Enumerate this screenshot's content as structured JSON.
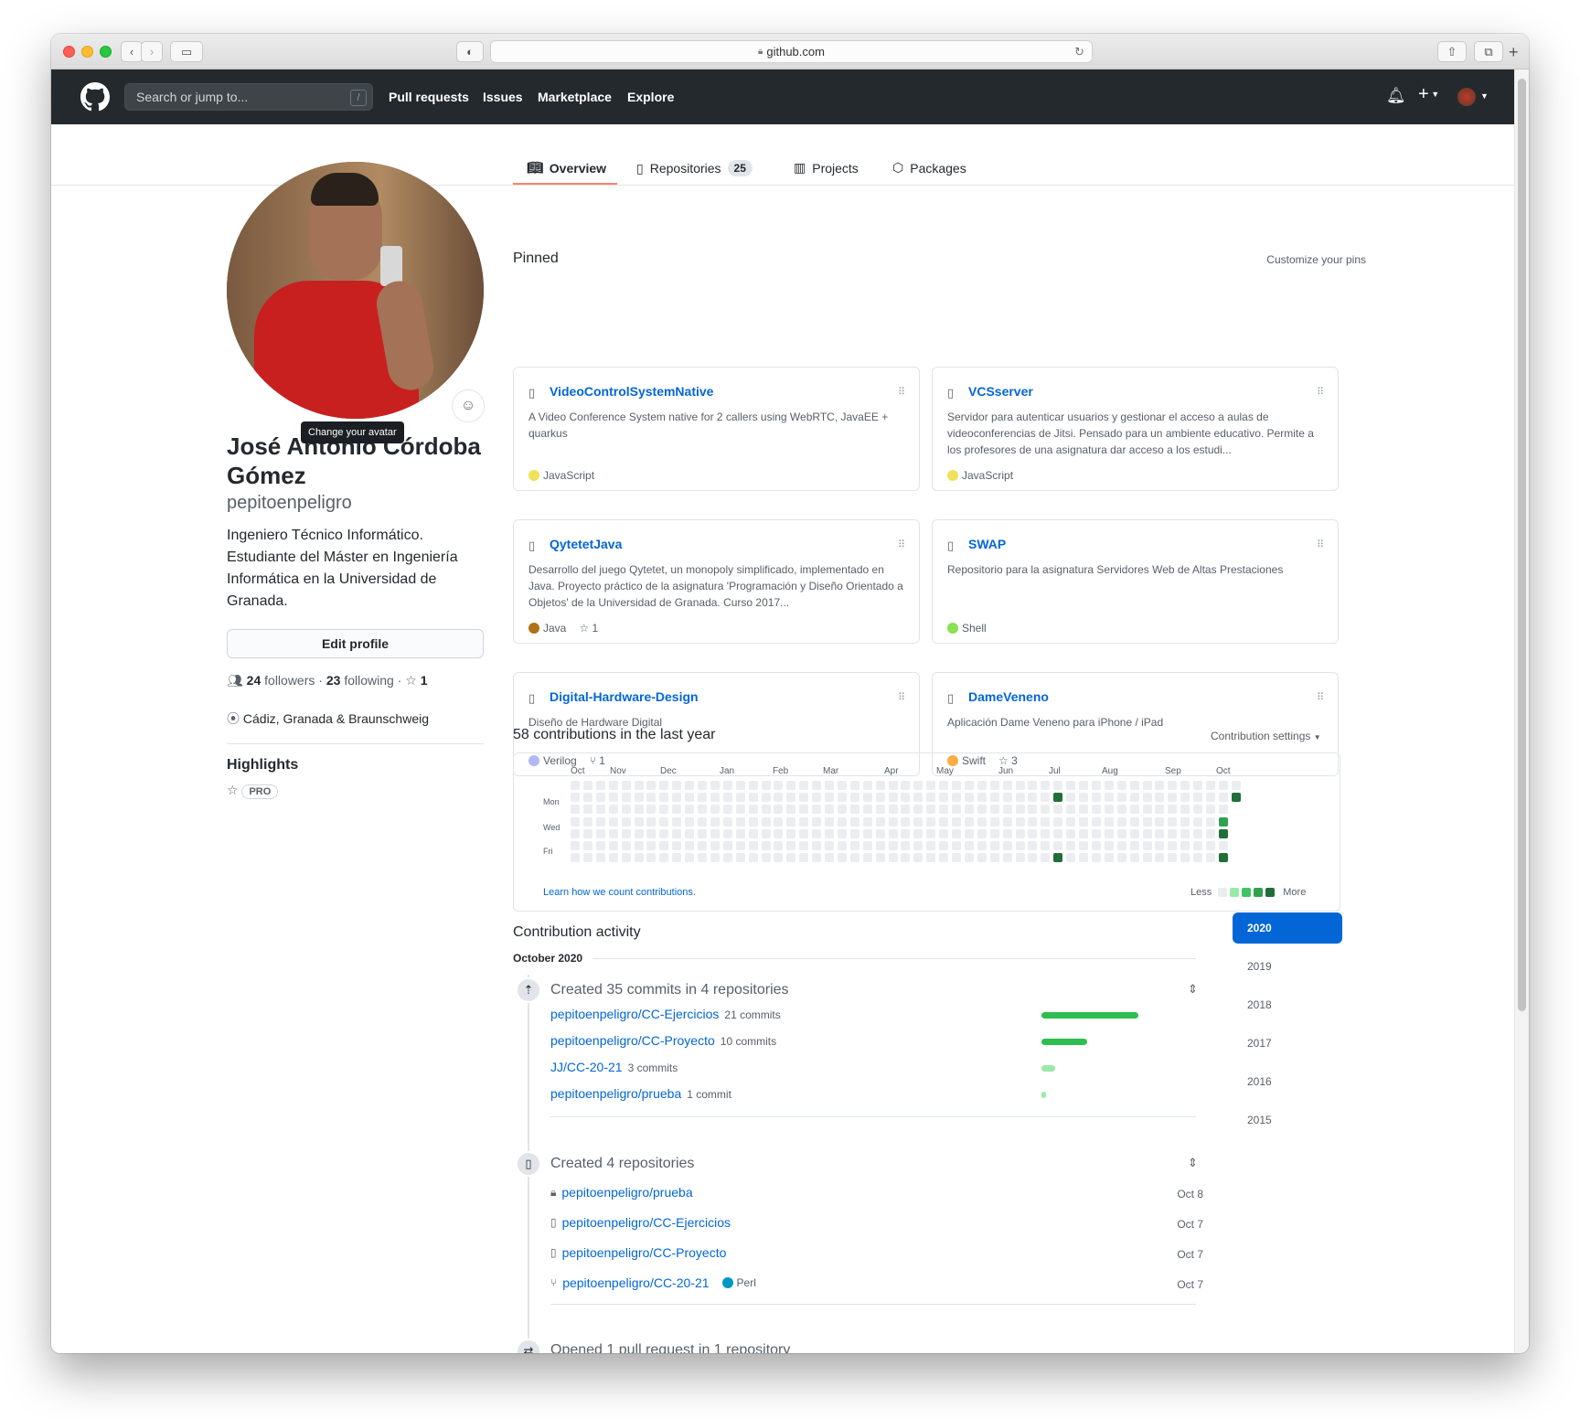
{
  "browser": {
    "url": "github.com"
  },
  "header": {
    "search_placeholder": "Search or jump to...",
    "search_key": "/",
    "nav": [
      "Pull requests",
      "Issues",
      "Marketplace",
      "Explore"
    ]
  },
  "tabs": {
    "overview": "Overview",
    "repositories": "Repositories",
    "repositories_count": "25",
    "projects": "Projects",
    "packages": "Packages"
  },
  "profile": {
    "tooltip": "Change your avatar",
    "name": "José Antonio Córdoba Gómez",
    "username": "pepitoenpeligro",
    "bio": "Ingeniero Técnico Informático. Estudiante del Máster en Ingeniería Informática en la Universidad de Granada.",
    "edit": "Edit profile",
    "followers": "24",
    "followers_label": "followers",
    "following": "23",
    "following_label": "following",
    "stars": "1",
    "location": "Cádiz, Granada & Braunschweig",
    "highlights": "Highlights",
    "pro": "PRO"
  },
  "pinned": {
    "title": "Pinned",
    "customize": "Customize your pins",
    "cards": [
      {
        "name": "VideoControlSystemNative",
        "desc": "A Video Conference System native for 2 callers using WebRTC, JavaEE + quarkus",
        "lang": "JavaScript",
        "color": "#f1e05a",
        "stars": "",
        "forks": ""
      },
      {
        "name": "VCSserver",
        "desc": "Servidor para autenticar usuarios y gestionar el acceso a aulas de videoconferencias de Jitsi. Pensado para un ambiente educativo. Permite a los profesores de una asignatura dar acceso a los estudi...",
        "lang": "JavaScript",
        "color": "#f1e05a",
        "stars": "",
        "forks": ""
      },
      {
        "name": "QytetetJava",
        "desc": "Desarrollo del juego Qytetet, un monopoly simplificado, implementado en Java. Proyecto práctico de la asignatura 'Programación y Diseño Orientado a Objetos' de la Universidad de Granada. Curso 2017...",
        "lang": "Java",
        "color": "#b07219",
        "stars": "1",
        "forks": ""
      },
      {
        "name": "SWAP",
        "desc": "Repositorio para la asignatura Servidores Web de Altas Prestaciones",
        "lang": "Shell",
        "color": "#89e051",
        "stars": "",
        "forks": ""
      },
      {
        "name": "Digital-Hardware-Design",
        "desc": "Diseño de Hardware Digital",
        "lang": "Verilog",
        "color": "#b2b7f8",
        "stars": "",
        "forks": "1"
      },
      {
        "name": "DameVeneno",
        "desc": "Aplicación Dame Veneno para iPhone / iPad",
        "lang": "Swift",
        "color": "#ffac45",
        "stars": "3",
        "forks": ""
      }
    ]
  },
  "contrib": {
    "title": "58 contributions in the last year",
    "settings": "Contribution settings",
    "months": [
      "Oct",
      "Nov",
      "Dec",
      "Jan",
      "Feb",
      "Mar",
      "Apr",
      "May",
      "Jun",
      "Jul",
      "Aug",
      "Sep",
      "Oct"
    ],
    "days": [
      "Mon",
      "Wed",
      "Fri"
    ],
    "learn": "Learn how we count contributions.",
    "less": "Less",
    "more": "More",
    "active_cells": [
      {
        "week": 38,
        "day": 1,
        "level": 4
      },
      {
        "week": 38,
        "day": 6,
        "level": 4
      },
      {
        "week": 51,
        "day": 3,
        "level": 3
      },
      {
        "week": 51,
        "day": 4,
        "level": 4
      },
      {
        "week": 51,
        "day": 6,
        "level": 4
      },
      {
        "week": 52,
        "day": 1,
        "level": 4
      }
    ],
    "legend_colors": [
      "#ebedf0",
      "#9be9a8",
      "#40c463",
      "#30a14e",
      "#216e39"
    ]
  },
  "activity": {
    "title": "Contribution activity",
    "month": "October 2020",
    "years": [
      "2020",
      "2019",
      "2018",
      "2017",
      "2016",
      "2015"
    ],
    "commits_title": "Created 35 commits in 4 repositories",
    "commits": [
      {
        "repo": "pepitoenpeligro/CC-Ejercicios",
        "count": "21 commits",
        "value": 21
      },
      {
        "repo": "pepitoenpeligro/CC-Proyecto",
        "count": "10 commits",
        "value": 10
      },
      {
        "repo": "JJ/CC-20-21",
        "count": "3 commits",
        "value": 3
      },
      {
        "repo": "pepitoenpeligro/prueba",
        "count": "1 commit",
        "value": 1
      }
    ],
    "repos_title": "Created 4 repositories",
    "repos": [
      {
        "name": "pepitoenpeligro/prueba",
        "date": "Oct 8",
        "lang": ""
      },
      {
        "name": "pepitoenpeligro/CC-Ejercicios",
        "date": "Oct 7",
        "lang": ""
      },
      {
        "name": "pepitoenpeligro/CC-Proyecto",
        "date": "Oct 7",
        "lang": ""
      },
      {
        "name": "pepitoenpeligro/CC-20-21",
        "date": "Oct 7",
        "lang": "Perl",
        "color": "#0298c3"
      }
    ],
    "pr_title": "Opened 1 pull request in 1 repository"
  }
}
